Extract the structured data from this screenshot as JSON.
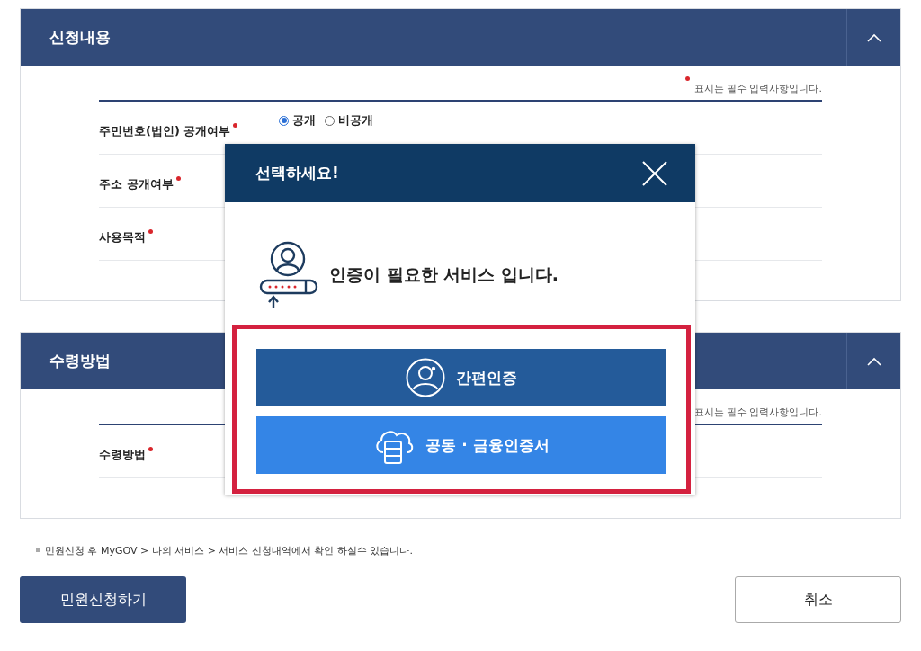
{
  "sections": [
    {
      "title": "신청내용",
      "expanded": true,
      "notice": "표시는 필수 입력사항입니다.",
      "fields": [
        {
          "label": "주민번호(법인) 공개여부",
          "required": true,
          "options": [
            {
              "label": "공개",
              "selected": true
            },
            {
              "label": "비공개",
              "selected": false
            }
          ]
        },
        {
          "label": "주소 공개여부",
          "required": true
        },
        {
          "label": "사용목적",
          "required": true
        }
      ]
    },
    {
      "title": "수령방법",
      "expanded": true,
      "notice": "표시는 필수 입력사항입니다.",
      "fields": [
        {
          "label": "수령방법",
          "required": true
        }
      ]
    }
  ],
  "footer_note": "민원신청 후 MyGOV > 나의 서비스 > 서비스 신청내역에서 확인 하실수 있습니다.",
  "buttons": [
    {
      "label": "민원신청하기",
      "kind": "primary"
    },
    {
      "label": "취소",
      "kind": "secondary"
    }
  ],
  "modal": {
    "title": "선택하세요!",
    "message": "인증이 필요한 서비스 입니다.",
    "highlighted": true,
    "options": [
      {
        "label": "간편인증",
        "kind": "simple"
      },
      {
        "label": "공동 · 금융인증서",
        "kind": "certificate"
      }
    ]
  }
}
